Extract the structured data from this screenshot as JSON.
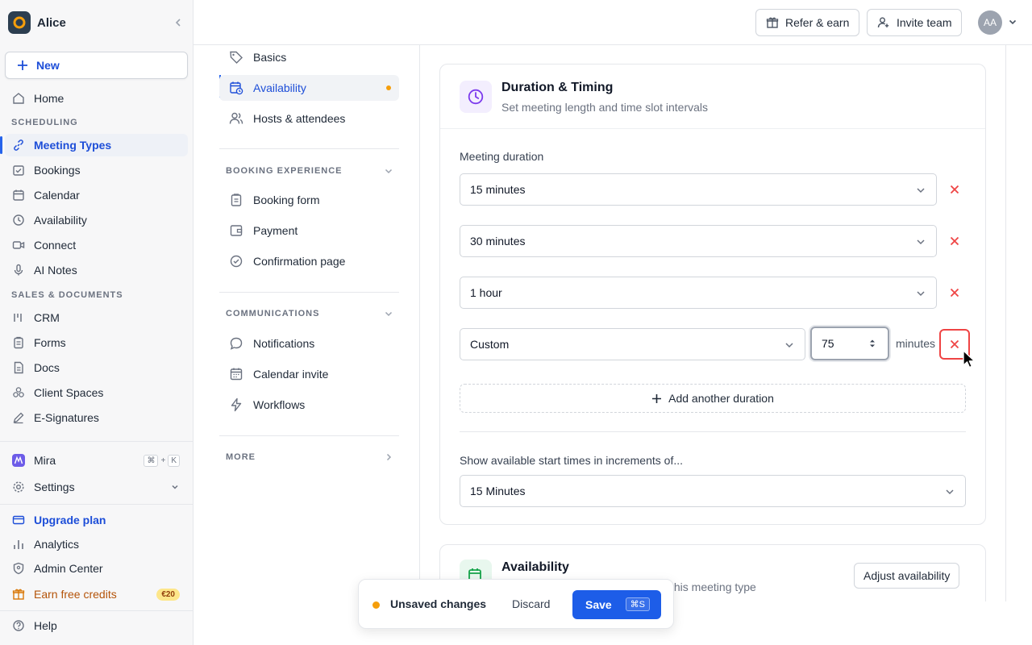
{
  "workspace": {
    "name": "Alice"
  },
  "sidebar": {
    "new_label": "New",
    "home": "Home",
    "section_scheduling": "SCHEDULING",
    "scheduling_items": [
      "Meeting Types",
      "Bookings",
      "Calendar",
      "Availability",
      "Connect",
      "AI Notes"
    ],
    "section_sales": "SALES & DOCUMENTS",
    "sales_items": [
      "CRM",
      "Forms",
      "Docs",
      "Client Spaces",
      "E-Signatures"
    ],
    "mira": "Mira",
    "mira_kbd": [
      "⌘",
      "+",
      "K"
    ],
    "settings": "Settings",
    "upgrade": "Upgrade plan",
    "analytics": "Analytics",
    "admin": "Admin Center",
    "earn": "Earn free credits",
    "earn_badge": "€20",
    "help": "Help"
  },
  "topbar": {
    "refer": "Refer & earn",
    "invite": "Invite team",
    "avatar_initials": "AA"
  },
  "subnav": {
    "top_items": [
      "Basics",
      "Availability",
      "Hosts & attendees"
    ],
    "section_booking": "BOOKING EXPERIENCE",
    "booking_items": [
      "Booking form",
      "Payment",
      "Confirmation page"
    ],
    "section_comms": "COMMUNICATIONS",
    "comms_items": [
      "Notifications",
      "Calendar invite",
      "Workflows"
    ],
    "section_more": "MORE"
  },
  "duration_card": {
    "title": "Duration & Timing",
    "subtitle": "Set meeting length and time slot intervals",
    "duration_label": "Meeting duration",
    "durations": [
      "15 minutes",
      "30 minutes",
      "1 hour",
      "Custom"
    ],
    "custom_value": "75",
    "custom_unit": "minutes",
    "add_label": "Add another duration",
    "increment_label": "Show available start times in increments of...",
    "increment_value": "15 Minutes"
  },
  "availability_card": {
    "title": "Availability",
    "subtitle_fragment": "this meeting type",
    "adjust": "Adjust availability"
  },
  "unsaved": {
    "text": "Unsaved changes",
    "discard": "Discard",
    "save": "Save",
    "save_kbd": "⌘S"
  },
  "colors": {
    "accent": "#1d4ed8",
    "danger": "#ef4444",
    "warning": "#f59e0b"
  }
}
